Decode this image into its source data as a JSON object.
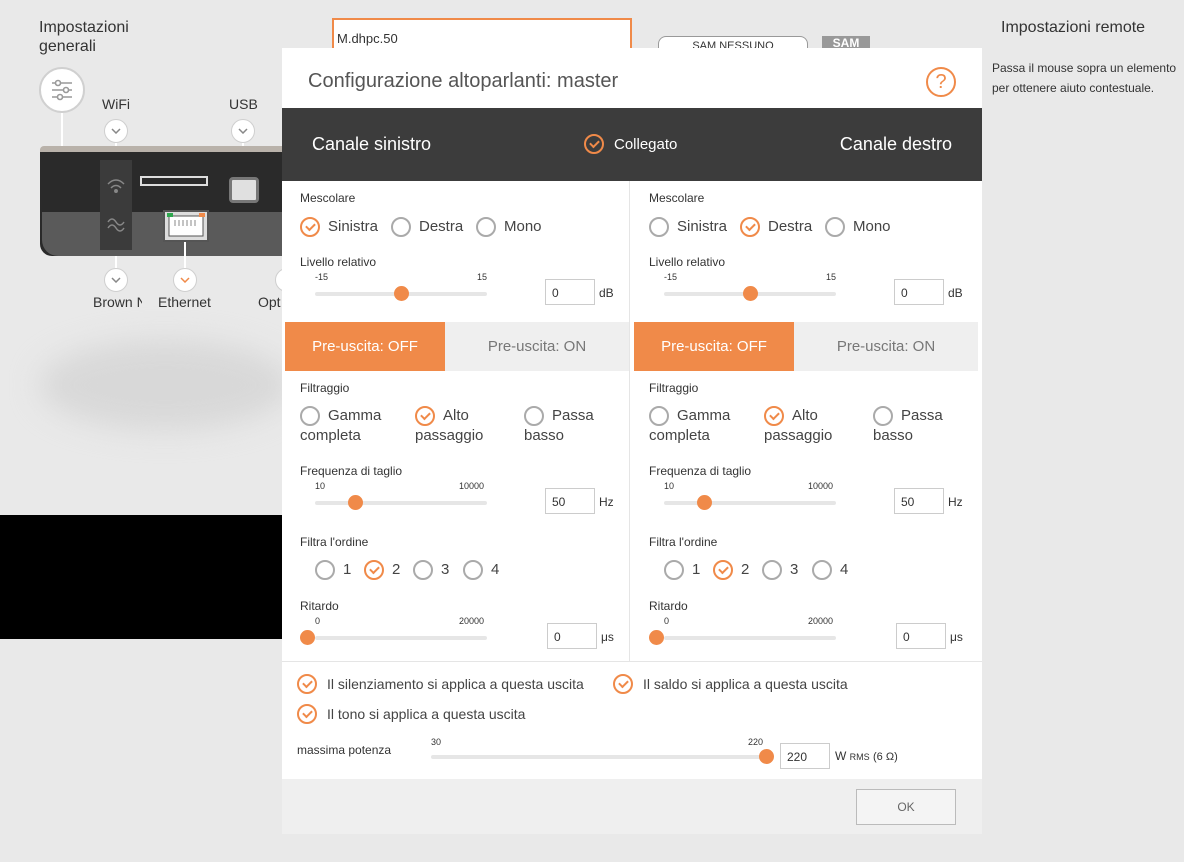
{
  "background": {
    "general_settings": "Impostazioni generali",
    "remote_settings": "Impostazioni remote",
    "help_text": "Passa il mouse sopra un elemento per ottenere aiuto contestuale.",
    "device_name": "M.dhpc.50",
    "sam_button": "SAM NESSUNO",
    "sam_logo": "SAM",
    "ports": {
      "wifi": "WiFi",
      "usb": "USB",
      "brown": "Brown N",
      "ethernet": "Ethernet",
      "optical": "Opt"
    }
  },
  "modal": {
    "title": "Configurazione altoparlanti: master",
    "help": "?",
    "left_channel_title": "Canale sinistro",
    "right_channel_title": "Canale destro",
    "linked_label": "Collegato",
    "labels": {
      "mix": "Mescolare",
      "relative_level": "Livello relativo",
      "filtering": "Filtraggio",
      "cutoff": "Frequenza di taglio",
      "order": "Filtra l'ordine",
      "delay": "Ritardo"
    },
    "mix_options": [
      "Sinistra",
      "Destra",
      "Mono"
    ],
    "filter_options": {
      "full_range_1": "Gamma",
      "full_range_2": "completa",
      "high_pass_1": "Alto",
      "high_pass_2": "passaggio",
      "low_pass_1": "Passa",
      "low_pass_2": "basso"
    },
    "order_options": [
      "1",
      "2",
      "3",
      "4"
    ],
    "pre_out_off": "Pre-uscita: OFF",
    "pre_out_on": "Pre-uscita: ON",
    "scales": {
      "level_min": "-15",
      "level_max": "15",
      "freq_min": "10",
      "freq_max": "10000",
      "delay_min": "0",
      "delay_max": "20000",
      "power_min": "30",
      "power_max": "220"
    },
    "units": {
      "db": "dB",
      "hz": "Hz",
      "us": "μs",
      "w": "W",
      "rms": "RMS",
      "ohm": "(6 Ω)"
    },
    "left": {
      "mix_selected": "Sinistra",
      "level": "0",
      "level_fraction": 0.5,
      "filter_selected": "Alto passaggio",
      "freq": "50",
      "freq_fraction": 0.23,
      "order_selected": "2",
      "delay": "0",
      "delay_fraction": 0.0
    },
    "right": {
      "mix_selected": "Destra",
      "level": "0",
      "level_fraction": 0.5,
      "filter_selected": "Alto passaggio",
      "freq": "50",
      "freq_fraction": 0.23,
      "order_selected": "2",
      "delay": "0",
      "delay_fraction": 0.0
    },
    "checks": {
      "mute": "Il silenziamento si applica a questa uscita",
      "balance": "Il saldo si applica a questa uscita",
      "tone": "Il tono si applica a questa uscita"
    },
    "max_power_label": "massima potenza",
    "max_power": "220",
    "max_power_fraction": 1.0,
    "ok": "OK"
  },
  "colors": {
    "accent": "#f08a49",
    "dark_bar": "#3c3c3c"
  }
}
